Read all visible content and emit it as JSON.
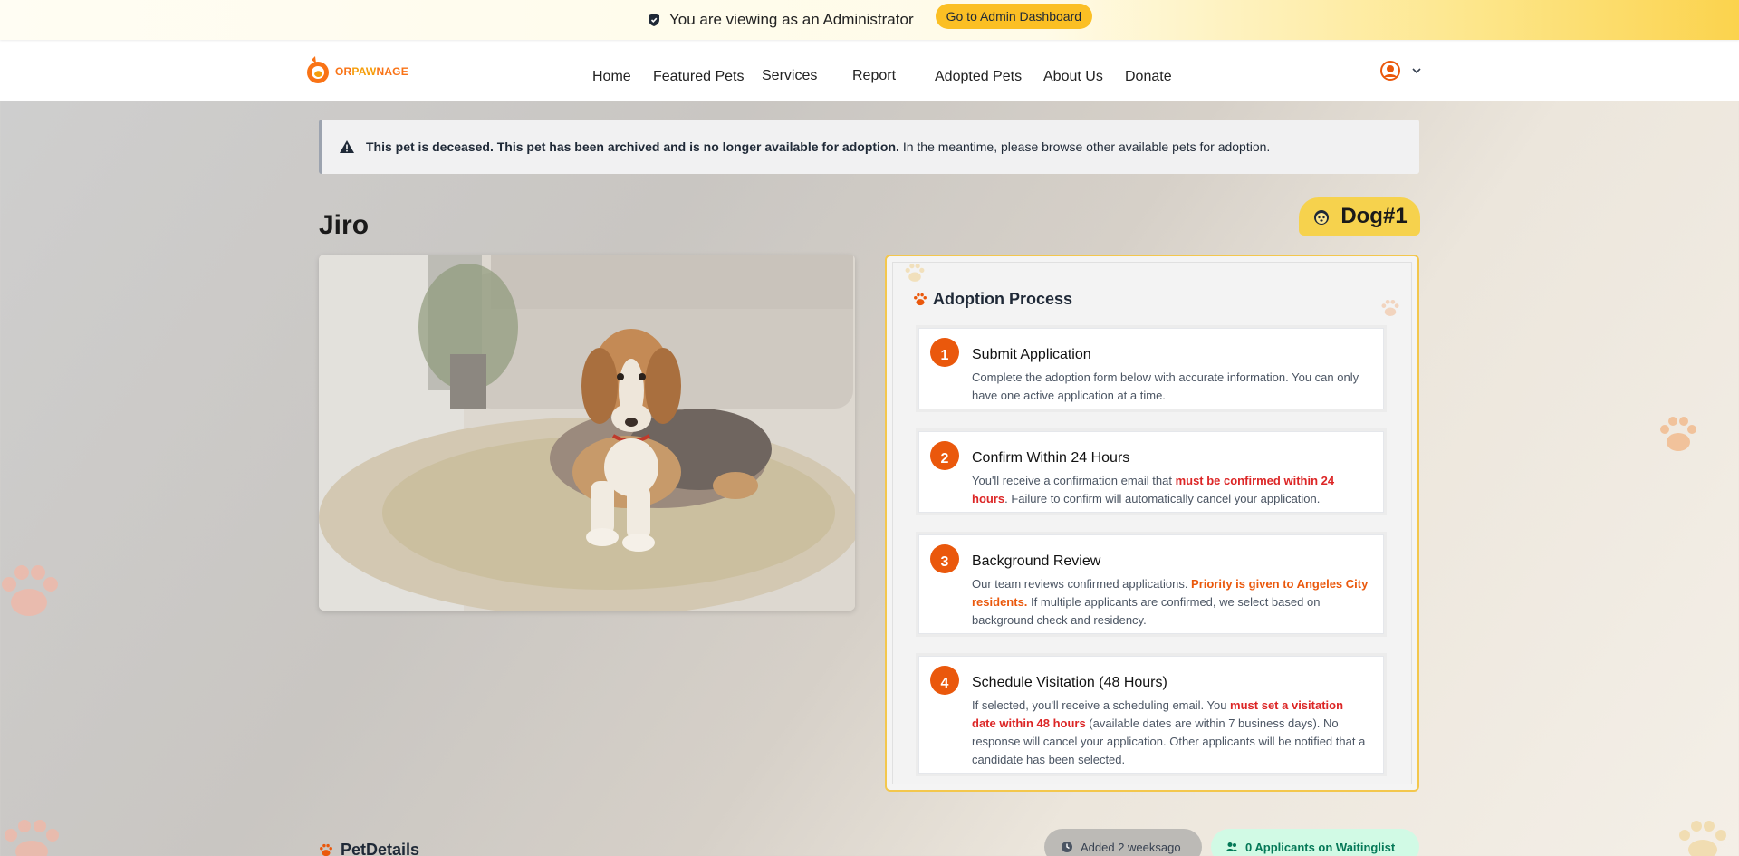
{
  "admin_banner": {
    "text": "You are viewing as an Administrator",
    "button_label": "Go to Admin Dashboard"
  },
  "logo": {
    "part1": "OR",
    "part2": "PAW",
    "part3": "NAGE"
  },
  "nav": {
    "home": "Home",
    "featured": "Featured Pets",
    "services": "Services",
    "report": "Report",
    "adopted": "Adopted Pets",
    "about": "About Us",
    "donate": "Donate"
  },
  "alert": {
    "bold": "This pet is deceased. This pet has been archived and is no longer available for adoption.",
    "rest": " In the meantime, please browse other available pets for adoption."
  },
  "pet": {
    "name": "Jiro",
    "tag": "Dog#1"
  },
  "process": {
    "heading": "Adoption Process",
    "steps": [
      {
        "num": "1",
        "title": "Submit Application",
        "text": "Complete the adoption form below with accurate information. You can only have one active application at a time."
      },
      {
        "num": "2",
        "title": "Confirm Within 24 Hours",
        "pre": "You'll receive a confirmation email that ",
        "hl": "must be confirmed within 24 hours",
        "post": ". Failure to confirm will automatically cancel your application."
      },
      {
        "num": "3",
        "title": "Background Review",
        "pre": "Our team reviews confirmed applications. ",
        "hl": "Priority is given to Angeles City residents.",
        "post": " If multiple applicants are confirmed, we select based on background check and residency."
      },
      {
        "num": "4",
        "title": "Schedule Visitation (48 Hours)",
        "pre": "If selected, you'll receive a scheduling email. You ",
        "hl": "must set a visitation date within 48 hours",
        "post": " (available dates are within 7 business days). No response will cancel your application. Other applicants will be notified that a candidate has been selected."
      }
    ]
  },
  "details": {
    "heading": "PetDetails",
    "added": "Added 2 weeksago",
    "waitlist": "0 Applicants on Waitinglist"
  },
  "colors": {
    "accent": "#ea580c",
    "yellow": "#fbbf24",
    "alert_red": "#dc2626"
  },
  "icons": [
    "shield-icon",
    "warning-icon",
    "paw-icon",
    "dog-face-icon",
    "user-circle-icon",
    "chevron-down-icon",
    "clock-icon",
    "users-icon"
  ]
}
